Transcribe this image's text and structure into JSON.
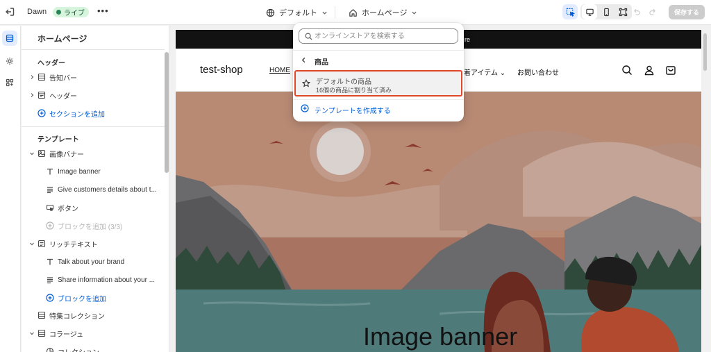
{
  "topbar": {
    "theme_name": "Dawn",
    "live_badge": "ライブ",
    "more_label": "•••",
    "template_selector": "デフォルト",
    "page_selector": "ホームページ",
    "save_label": "保存する"
  },
  "sidebar": {
    "title": "ホームページ",
    "header_heading": "ヘッダー",
    "header_items": [
      {
        "label": "告知バー",
        "icon": "section-icon"
      },
      {
        "label": "ヘッダー",
        "icon": "header-section-icon"
      }
    ],
    "add_section_label": "セクションを追加",
    "template_heading": "テンプレート",
    "image_banner": {
      "label": "画像バナー",
      "blocks": [
        {
          "label": "Image banner",
          "icon": "text-icon"
        },
        {
          "label": "Give customers details about t...",
          "icon": "paragraph-icon"
        },
        {
          "label": "ボタン",
          "icon": "button-icon"
        }
      ],
      "add_block_label": "ブロックを追加 (3/3)"
    },
    "rich_text": {
      "label": "リッチテキスト",
      "blocks": [
        {
          "label": "Talk about your brand",
          "icon": "text-icon"
        },
        {
          "label": "Share information about your ...",
          "icon": "paragraph-icon"
        }
      ],
      "add_block_label": "ブロックを追加"
    },
    "featured_collection_label": "特集コレクション",
    "collage": {
      "label": "コラージュ",
      "first_block": "コレクション"
    }
  },
  "dropdown": {
    "search_placeholder": "オンラインストアを検索する",
    "back_label": "商品",
    "option_title": "デフォルトの商品",
    "option_subtitle": "16個の商品に割り当て済み",
    "create_label": "テンプレートを作成する"
  },
  "preview": {
    "announcement": "re",
    "logo": "test-shop",
    "nav": [
      "HOME",
      "着アイテム ⌄",
      "お問い合わせ"
    ],
    "hero_title": "Image banner"
  },
  "colors": {
    "accent": "#005bd3",
    "live_badge_bg": "#d7f5dd",
    "highlight_border": "#e0482a",
    "announcement_bg": "#121212"
  }
}
